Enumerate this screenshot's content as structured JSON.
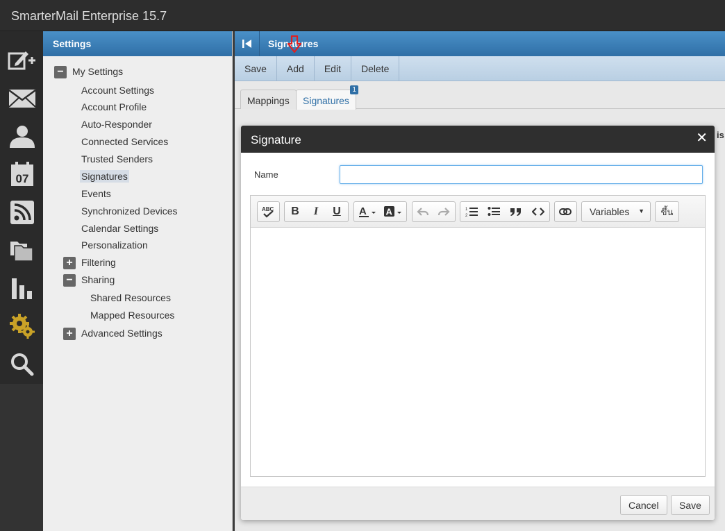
{
  "app": {
    "title": "SmarterMail Enterprise 15.7"
  },
  "rail": {
    "icons": [
      "compose-icon",
      "mail-icon",
      "contacts-icon",
      "calendar-icon",
      "rss-icon",
      "files-icon",
      "reports-icon",
      "settings-icon",
      "search-icon"
    ],
    "calendar_day": "07",
    "active_color": "#c9a227"
  },
  "settings": {
    "header": "Settings",
    "tree": {
      "my_settings": "My Settings",
      "account_settings": "Account Settings",
      "account_profile": "Account Profile",
      "auto_responder": "Auto-Responder",
      "connected_services": "Connected Services",
      "trusted_senders": "Trusted Senders",
      "signatures": "Signatures",
      "events": "Events",
      "synchronized_devices": "Synchronized Devices",
      "calendar_settings": "Calendar Settings",
      "personalization": "Personalization",
      "filtering": "Filtering",
      "sharing": "Sharing",
      "shared_resources": "Shared Resources",
      "mapped_resources": "Mapped Resources",
      "advanced_settings": "Advanced Settings"
    },
    "expand_symbol": "+",
    "collapse_symbol": "−"
  },
  "main": {
    "header": "Signatures",
    "toolbar": {
      "save": "Save",
      "add": "Add",
      "edit": "Edit",
      "delete": "Delete"
    },
    "tabs": {
      "mappings": "Mappings",
      "signatures": "Signatures",
      "signatures_badge": "1"
    },
    "cut_text": "is"
  },
  "modal": {
    "title": "Signature",
    "close": "✕",
    "name_label": "Name",
    "name_value": "",
    "variables_label": "Variables",
    "thai_button": "ขึ้น",
    "cancel": "Cancel",
    "save": "Save"
  },
  "colors": {
    "header_blue": "#2f6fa6",
    "toolbar_blue": "#b9cfe3",
    "annotation_red": "#e02020"
  }
}
